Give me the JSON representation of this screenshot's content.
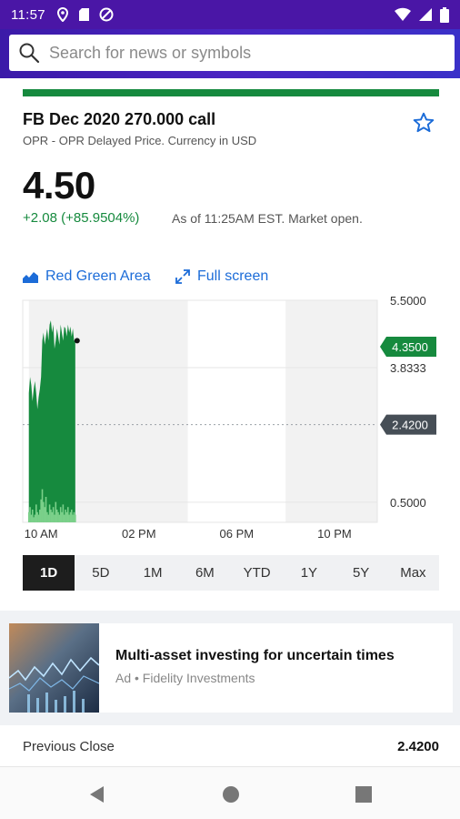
{
  "status_bar": {
    "time": "11:57",
    "icons_left": [
      "location-icon",
      "sd-card-icon",
      "do-not-disturb-icon"
    ],
    "icons_right": [
      "wifi-icon",
      "cellular-icon",
      "battery-icon"
    ]
  },
  "search": {
    "placeholder": "Search for news or symbols"
  },
  "quote": {
    "title": "FB Dec 2020 270.000 call",
    "subtitle": "OPR - OPR Delayed Price. Currency in USD",
    "price": "4.50",
    "change": "+2.08 (+85.9504%)",
    "as_of": "As of 11:25AM EST. Market open."
  },
  "chart_controls": {
    "chart_type_label": "Red Green Area",
    "fullscreen_label": "Full screen"
  },
  "chart_data": {
    "type": "area",
    "y_ticks": [
      "5.5000",
      "3.8333",
      "0.5000"
    ],
    "x_ticks": [
      "10 AM",
      "02 PM",
      "06 PM",
      "10 PM"
    ],
    "current_price_label": "4.3500",
    "previous_close_label": "2.4200",
    "ylim": [
      0,
      5.5
    ],
    "series_x_hours": [
      9.5,
      9.55,
      9.6,
      9.65,
      9.7,
      9.75,
      9.8,
      9.85,
      9.9,
      9.95,
      10.0,
      10.05,
      10.1,
      10.15,
      10.2,
      10.25,
      10.3,
      10.35,
      10.4,
      10.45,
      10.5,
      10.55,
      10.6,
      10.65,
      10.7,
      10.75,
      10.8,
      10.85,
      10.9,
      10.95,
      11.0,
      11.05,
      11.1,
      11.15,
      11.2,
      11.25,
      11.3,
      11.35,
      11.4
    ],
    "series_values": [
      3.2,
      3.6,
      3.4,
      3.0,
      3.3,
      3.5,
      3.2,
      2.8,
      3.1,
      3.3,
      3.6,
      4.5,
      4.7,
      4.4,
      4.6,
      4.8,
      4.5,
      4.9,
      5.0,
      4.7,
      4.9,
      4.3,
      4.5,
      4.8,
      4.6,
      4.4,
      4.9,
      4.7,
      4.5,
      4.85,
      4.8,
      4.6,
      4.9,
      4.7,
      4.85,
      4.6,
      4.8,
      4.5,
      4.5
    ],
    "volume_values": [
      0.4,
      0.6,
      0.3,
      0.5,
      0.2,
      0.3,
      0.7,
      0.4,
      0.3,
      0.5,
      0.9,
      1.3,
      0.8,
      0.6,
      1.0,
      0.4,
      0.3,
      0.7,
      0.5,
      0.4,
      0.6,
      0.3,
      0.8,
      0.5,
      0.4,
      0.3,
      0.6,
      0.4,
      0.7,
      0.3,
      0.5,
      0.4,
      0.6,
      0.3,
      0.4,
      0.5,
      0.3,
      0.4,
      0.3
    ],
    "colors": {
      "area": "#168a3e",
      "volume": "#7bd08a",
      "current_tag": "#168a3e",
      "prev_close_tag": "#464e56"
    }
  },
  "ranges": [
    {
      "label": "1D",
      "active": true
    },
    {
      "label": "5D",
      "active": false
    },
    {
      "label": "1M",
      "active": false
    },
    {
      "label": "6M",
      "active": false
    },
    {
      "label": "YTD",
      "active": false
    },
    {
      "label": "1Y",
      "active": false
    },
    {
      "label": "5Y",
      "active": false
    },
    {
      "label": "Max",
      "active": false
    }
  ],
  "ad": {
    "title": "Multi-asset investing for uncertain times",
    "sponsor": "Ad • Fidelity Investments"
  },
  "stats": {
    "previous_close_label": "Previous Close",
    "previous_close_value": "2.4200"
  },
  "nav": [
    "back-icon",
    "home-icon",
    "recents-icon"
  ]
}
